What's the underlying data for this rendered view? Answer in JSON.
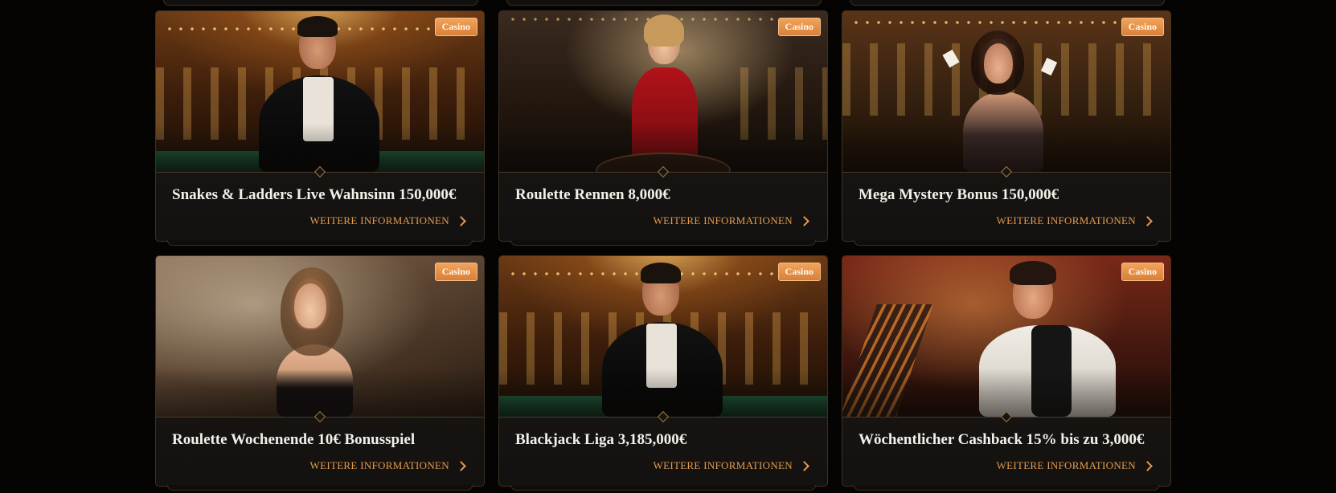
{
  "colors": {
    "background": "#050403",
    "card": "#1a1715",
    "border": "#3e3122",
    "accent": "#e39a4c",
    "badge": "#e8914a"
  },
  "more_label": "WEITERE INFORMATIONEN",
  "cards": [
    {
      "badge": "Casino",
      "title": "Snakes & Ladders Live Wahnsinn 150,000€",
      "link_icon": "chevron-right-icon"
    },
    {
      "badge": "Casino",
      "title": "Roulette Rennen 8,000€",
      "link_icon": "chevron-right-icon"
    },
    {
      "badge": "Casino",
      "title": "Mega Mystery Bonus 150,000€",
      "link_icon": "chevron-right-icon"
    },
    {
      "badge": "Casino",
      "title": "Roulette Wochenende 10€ Bonusspiel",
      "link_icon": "chevron-right-icon"
    },
    {
      "badge": "Casino",
      "title": "Blackjack Liga 3,185,000€",
      "link_icon": "chevron-right-icon"
    },
    {
      "badge": "Casino",
      "title": "Wöchentlicher Cashback 15% bis zu 3,000€",
      "link_icon": "chevron-right-icon"
    }
  ]
}
